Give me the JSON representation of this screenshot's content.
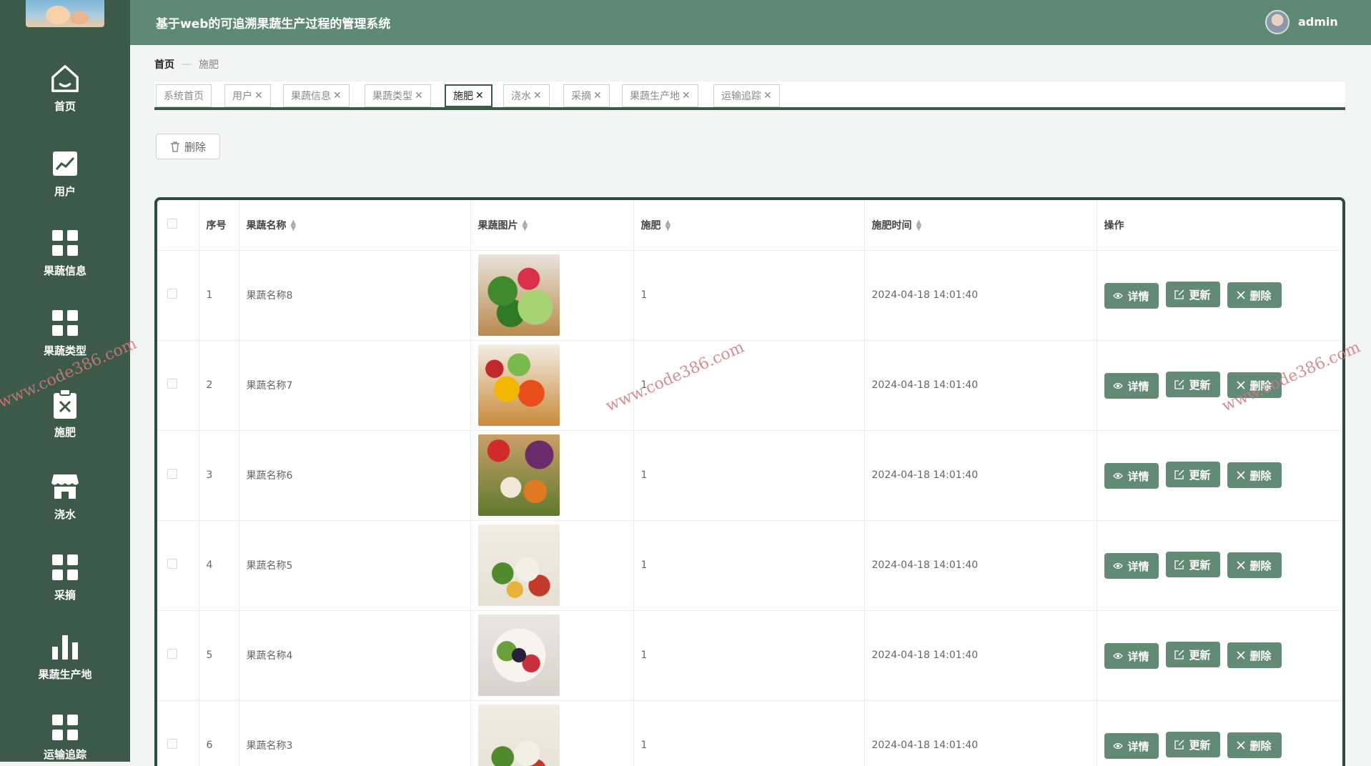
{
  "app": {
    "title": "基于web的可追溯果蔬生产过程的管理系统",
    "user": "admin"
  },
  "sidebar": {
    "items": [
      {
        "label": "首页",
        "icon": "home-icon"
      },
      {
        "label": "用户",
        "icon": "chart-line-icon"
      },
      {
        "label": "果蔬信息",
        "icon": "grid-icon"
      },
      {
        "label": "果蔬类型",
        "icon": "grid-icon"
      },
      {
        "label": "施肥",
        "icon": "clipboard-x-icon"
      },
      {
        "label": "浇水",
        "icon": "store-icon"
      },
      {
        "label": "采摘",
        "icon": "grid-icon"
      },
      {
        "label": "果蔬生产地",
        "icon": "bar-chart-icon"
      },
      {
        "label": "运输追踪",
        "icon": "grid-icon"
      }
    ]
  },
  "breadcrumb": {
    "home": "首页",
    "sep": "—",
    "current": "施肥"
  },
  "tabs": [
    {
      "label": "系统首页",
      "closable": false
    },
    {
      "label": "用户",
      "closable": true
    },
    {
      "label": "果蔬信息",
      "closable": true
    },
    {
      "label": "果蔬类型",
      "closable": true
    },
    {
      "label": "施肥",
      "closable": true,
      "active": true
    },
    {
      "label": "浇水",
      "closable": true
    },
    {
      "label": "采摘",
      "closable": true
    },
    {
      "label": "果蔬生产地",
      "closable": true
    },
    {
      "label": "运输追踪",
      "closable": true
    }
  ],
  "toolbar": {
    "delete_label": "删除"
  },
  "table": {
    "columns": [
      "序号",
      "果蔬名称",
      "果蔬图片",
      "施肥",
      "施肥时间",
      "操作"
    ],
    "rows": [
      {
        "index": "1",
        "name": "果蔬名称8",
        "fertilizer": "1",
        "time": "2024-04-18 14:01:40"
      },
      {
        "index": "2",
        "name": "果蔬名称7",
        "fertilizer": "1",
        "time": "2024-04-18 14:01:40"
      },
      {
        "index": "3",
        "name": "果蔬名称6",
        "fertilizer": "1",
        "time": "2024-04-18 14:01:40"
      },
      {
        "index": "4",
        "name": "果蔬名称5",
        "fertilizer": "1",
        "time": "2024-04-18 14:01:40"
      },
      {
        "index": "5",
        "name": "果蔬名称4",
        "fertilizer": "1",
        "time": "2024-04-18 14:01:40"
      },
      {
        "index": "6",
        "name": "果蔬名称3",
        "fertilizer": "1",
        "time": "2024-04-18 14:01:40"
      }
    ],
    "actions": {
      "detail": "详情",
      "update": "更新",
      "delete": "删除"
    }
  },
  "watermark": "www.code386.com",
  "colors": {
    "sidebar": "#3d5a48",
    "header": "#5e8a74",
    "button": "#628a75",
    "tabs_border": "#3a5a48"
  }
}
